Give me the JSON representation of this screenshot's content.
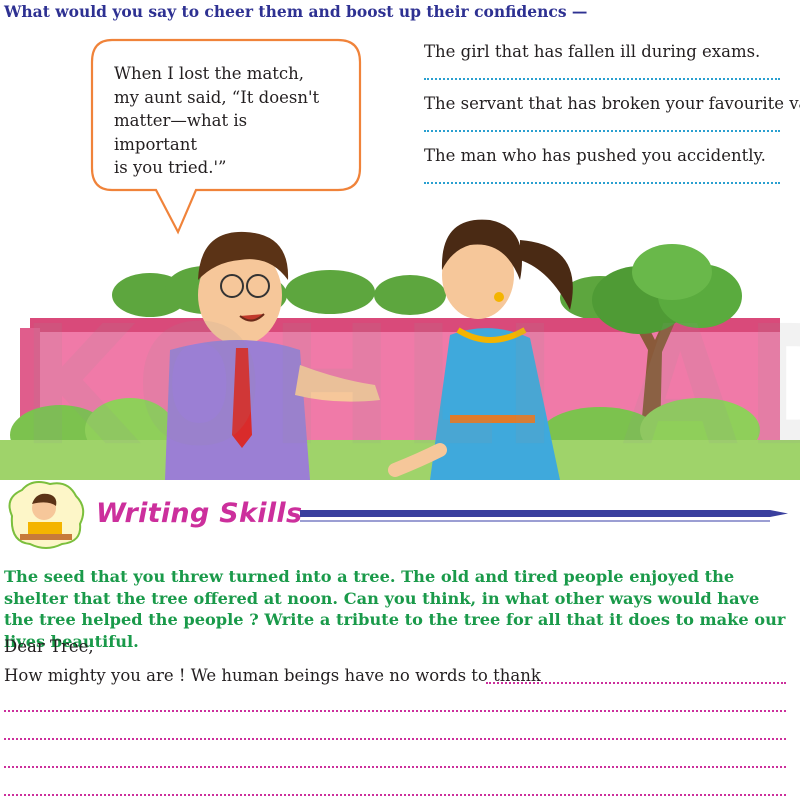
{
  "heading": "What would you say to cheer them and boost up their confidencs —",
  "speech_bubble": {
    "lines": [
      "When I lost the match,",
      "my aunt said, “It doesn't",
      "matter—what is important",
      "is you tried.'”"
    ]
  },
  "prompts": [
    "The girl that has fallen ill during exams.",
    "The servant that has broken your favourite vase.",
    "The man who has pushed you accidently."
  ],
  "watermark": "KOHLI ADS.",
  "section_title": "Writing Skills",
  "task_text": "The seed that you threw turned into a tree. The old and tired people enjoyed the shelter that the tree offered at noon. Can you think, in what other ways would have the tree helped the people ? Write a tribute to the tree for all that it does to make our lives beautiful.",
  "letter": {
    "salutation": "Dear Tree,",
    "opening": "How mighty you are ! We human beings have no words to thank"
  },
  "colors": {
    "heading": "#2e3192",
    "bubble_border": "#f0833a",
    "prompt_dots": "#2aa0d0",
    "title": "#cc2f9c",
    "task": "#1a9a4a",
    "answer_dots": "#cc2f9c"
  },
  "icons": [
    "speech-bubble",
    "boy-character",
    "girl-character",
    "tree",
    "hedge",
    "wall",
    "student-writing-icon",
    "pen-icon"
  ]
}
